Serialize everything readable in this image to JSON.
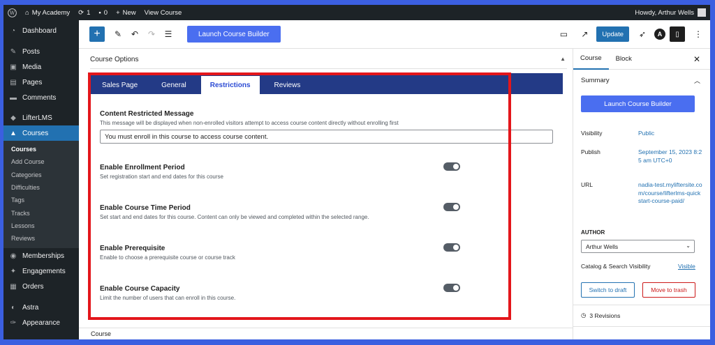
{
  "admin_bar": {
    "site_name": "My Academy",
    "updates_count": "1",
    "comments_count": "0",
    "new_label": "New",
    "view_label": "View Course",
    "howdy": "Howdy, Arthur Wells"
  },
  "sidebar": {
    "items": [
      {
        "label": "Dashboard",
        "icon": "dashboard-icon"
      },
      {
        "label": "Posts",
        "icon": "pin-icon"
      },
      {
        "label": "Media",
        "icon": "media-icon"
      },
      {
        "label": "Pages",
        "icon": "pages-icon"
      },
      {
        "label": "Comments",
        "icon": "comment-icon"
      },
      {
        "label": "LifterLMS",
        "icon": "lifterlms-icon"
      },
      {
        "label": "Courses",
        "icon": "graduation-cap-icon"
      }
    ],
    "submenu": [
      "Courses",
      "Add Course",
      "Categories",
      "Difficulties",
      "Tags",
      "Tracks",
      "Lessons",
      "Reviews"
    ],
    "bottom_items": [
      {
        "label": "Memberships",
        "icon": "memberships-icon"
      },
      {
        "label": "Engagements",
        "icon": "engagements-icon"
      },
      {
        "label": "Orders",
        "icon": "cart-icon"
      },
      {
        "label": "Astra",
        "icon": "astra-icon"
      },
      {
        "label": "Appearance",
        "icon": "brush-icon"
      }
    ]
  },
  "toolbar": {
    "launch_label": "Launch Course Builder",
    "update_label": "Update"
  },
  "course_options": {
    "title": "Course Options",
    "tabs": [
      "Sales Page",
      "General",
      "Restrictions",
      "Reviews"
    ],
    "active_tab": "Restrictions",
    "content_restricted": {
      "title": "Content Restricted Message",
      "description": "This message will be displayed when non-enrolled visitors attempt to access course content directly without enrolling first",
      "value": "You must enroll in this course to access course content."
    },
    "fields": [
      {
        "title": "Enable Enrollment Period",
        "description": "Set registration start and end dates for this course",
        "enabled": false
      },
      {
        "title": "Enable Course Time Period",
        "description": "Set start and end dates for this course. Content can only be viewed and completed within the selected range.",
        "enabled": false
      },
      {
        "title": "Enable Prerequisite",
        "description": "Enable to choose a prerequisite course or course track",
        "enabled": false
      },
      {
        "title": "Enable Course Capacity",
        "description": "Limit the number of users that can enroll in this course.",
        "enabled": false
      }
    ]
  },
  "footer": {
    "breadcrumb": "Course"
  },
  "settings_panel": {
    "tabs": [
      "Course",
      "Block"
    ],
    "summary_label": "Summary",
    "launch_label": "Launch Course Builder",
    "visibility_label": "Visibility",
    "visibility_value": "Public",
    "publish_label": "Publish",
    "publish_value": "September 15, 2023 8:25 am UTC+0",
    "url_label": "URL",
    "url_value": "nadia-test.myliftersite.com/course/lifterlms-quickstart-course-paid/",
    "author_label": "AUTHOR",
    "author_value": "Arthur Wells",
    "catalog_label": "Catalog & Search Visibility",
    "catalog_value": "Visible",
    "switch_draft": "Switch to draft",
    "move_trash": "Move to trash",
    "revisions": "3 Revisions"
  },
  "colors": {
    "accent": "#2271b1",
    "launch": "#4a6ef0",
    "tabs_bar": "#233a86",
    "highlight_border": "#e3161b"
  }
}
